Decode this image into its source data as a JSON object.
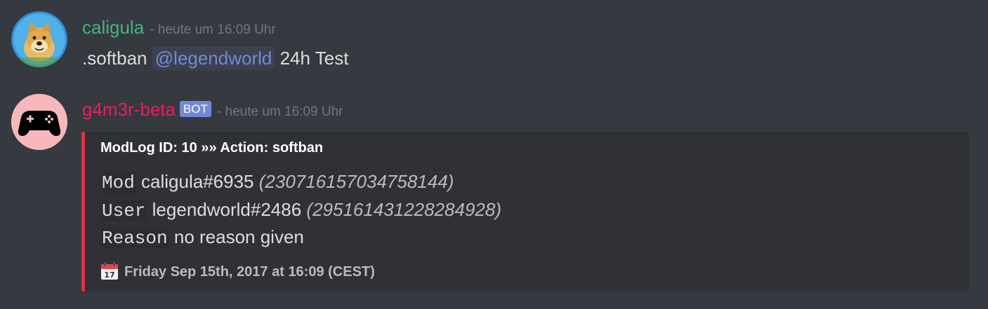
{
  "messages": [
    {
      "author": "caligula",
      "author_color": "#43b581",
      "timestamp": "- heute um 16:09 Uhr",
      "content_prefix": ".softban",
      "mention": "@legendworld",
      "content_suffix": "24h Test"
    },
    {
      "author": "g4m3r-beta",
      "author_color": "#e91e63",
      "bot_tag": "BOT",
      "timestamp": "- heute um 16:09 Uhr",
      "embed": {
        "accent_color": "#d9363e",
        "title": "ModLog ID: 10 »» Action: softban",
        "fields": [
          {
            "key": "Mod",
            "value": "caligula#6935",
            "id": "(230716157034758144)"
          },
          {
            "key": "User",
            "value": "legendworld#2486",
            "id": "(295161431228284928)"
          },
          {
            "key": "Reason",
            "value": "no reason given"
          }
        ],
        "footer_icon": "calendar-icon",
        "footer": "Friday Sep 15th, 2017 at 16:09 (CEST)"
      }
    }
  ]
}
